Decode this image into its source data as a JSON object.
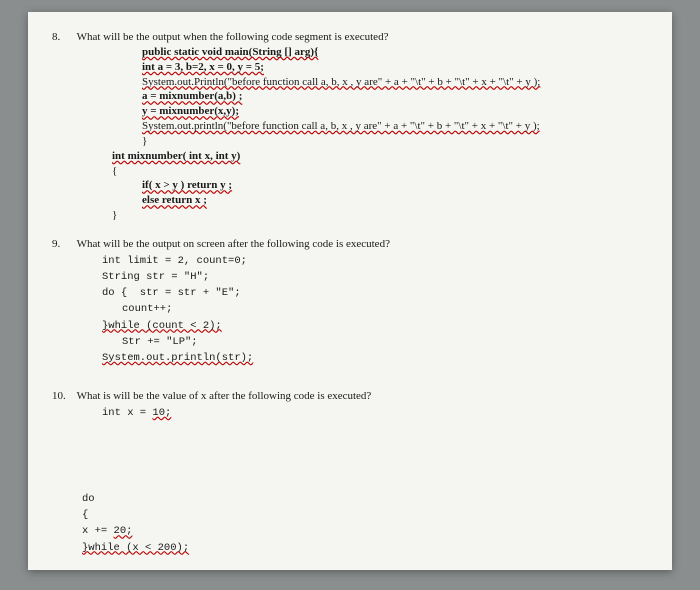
{
  "q8": {
    "num": "8.",
    "prompt": "What will be the output when the following code segment is executed?",
    "lines": [
      "public static void main(String [] arg){",
      "int a = 3, b=2, x = 0, y = 5;",
      "System.out.Println(\"before function call a,  b, x , y are\" + a + \"\\t\" + b + \"\\t\"   + x + \"\\t\" +  y );",
      "a = mixnumber(a,b) ;",
      "y = mixnumber(x,y);",
      "System.out.println(\"before function call a,  b, x , y are\" + a + \"\\t\" + b + \"\\t\"   + x + \"\\t\" +  y );",
      "}",
      "int mixnumber( int x, int y)",
      "{",
      "if( x > y ) return y ;",
      "else return x ;",
      "}"
    ]
  },
  "q9": {
    "num": "9.",
    "prompt": "What will be the output on screen after the following code is executed?",
    "lines": [
      "int limit = 2, count=0;",
      "String str = \"H\";",
      "do {  str = str + \"E\";",
      "count++;",
      "}while (count < 2);",
      "Str += \"LP\";",
      "System.out.println(str);"
    ]
  },
  "q10": {
    "num": "10.",
    "prompt": "What is will be the value of x after the following code is executed?",
    "lines": [
      "int x = 10;",
      "do",
      "{",
      "x += 20;",
      "}while (x < 200);"
    ]
  }
}
